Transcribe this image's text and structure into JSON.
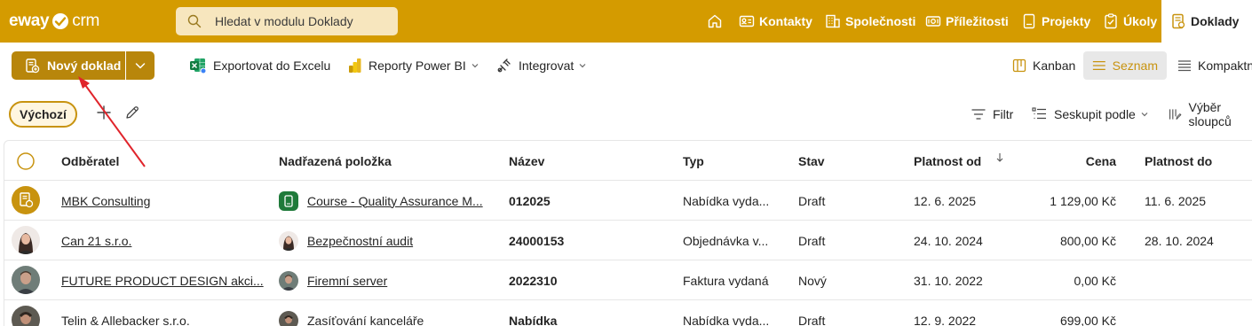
{
  "app": {
    "logo_left": "eway",
    "logo_right": "crm"
  },
  "search": {
    "placeholder": "Hledat v modulu Doklady"
  },
  "nav": [
    {
      "label": "Kontakty",
      "icon": "contacts-icon"
    },
    {
      "label": "Společnosti",
      "icon": "companies-icon"
    },
    {
      "label": "Příležitosti",
      "icon": "opportunities-icon"
    },
    {
      "label": "Projekty",
      "icon": "projects-icon"
    },
    {
      "label": "Úkoly",
      "icon": "tasks-icon"
    },
    {
      "label": "Doklady",
      "icon": "documents-icon",
      "active": true
    }
  ],
  "toolbar": {
    "new_label": "Nový doklad",
    "export_label": "Exportovat do Excelu",
    "powerbi_label": "Reporty Power BI",
    "integrate_label": "Integrovat",
    "views": {
      "kanban": "Kanban",
      "list": "Seznam",
      "compact": "Kompaktní"
    }
  },
  "filters": {
    "active_view": "Výchozí",
    "filter_label": "Filtr",
    "group_label": "Seskupit podle",
    "columns_label": "Výběr sloupců"
  },
  "table": {
    "columns": {
      "customer": "Odběratel",
      "parent": "Nadřazená položka",
      "name": "Název",
      "type": "Typ",
      "status": "Stav",
      "valid_from": "Platnost od",
      "price": "Cena",
      "valid_to": "Platnost do"
    },
    "sort": {
      "column": "valid_from",
      "direction": "descending"
    },
    "rows": [
      {
        "customer": "MBK Consulting",
        "parent": "Course - Quality Assurance M...",
        "name": "012025",
        "type": "Nabídka vyda...",
        "status": "Draft",
        "valid_from": "12. 6. 2025",
        "price": "1 129,00 Kč",
        "valid_to": "11. 6. 2025"
      },
      {
        "customer": "Can 21 s.r.o.",
        "parent": "Bezpečnostní audit",
        "name": "24000153",
        "type": "Objednávka v...",
        "status": "Draft",
        "valid_from": "24. 10. 2024",
        "price": "800,00 Kč",
        "valid_to": "28. 10. 2024"
      },
      {
        "customer": "FUTURE PRODUCT DESIGN akci...",
        "parent": "Firemní server",
        "name": "2022310",
        "type": "Faktura vydaná",
        "status": "Nový",
        "valid_from": "31. 10. 2022",
        "price": "0,00 Kč",
        "valid_to": ""
      },
      {
        "customer": "Telin & Allebacker s.r.o.",
        "parent": "Zasíťování kanceláře",
        "name": "Nabídka",
        "type": "Nabídka vyda...",
        "status": "Draft",
        "valid_from": "12. 9. 2022",
        "price": "699,00 Kč",
        "valid_to": ""
      }
    ]
  },
  "colors": {
    "brand": "#d49b00",
    "button": "#b8860b",
    "annotation_arrow": "#e0242b"
  }
}
